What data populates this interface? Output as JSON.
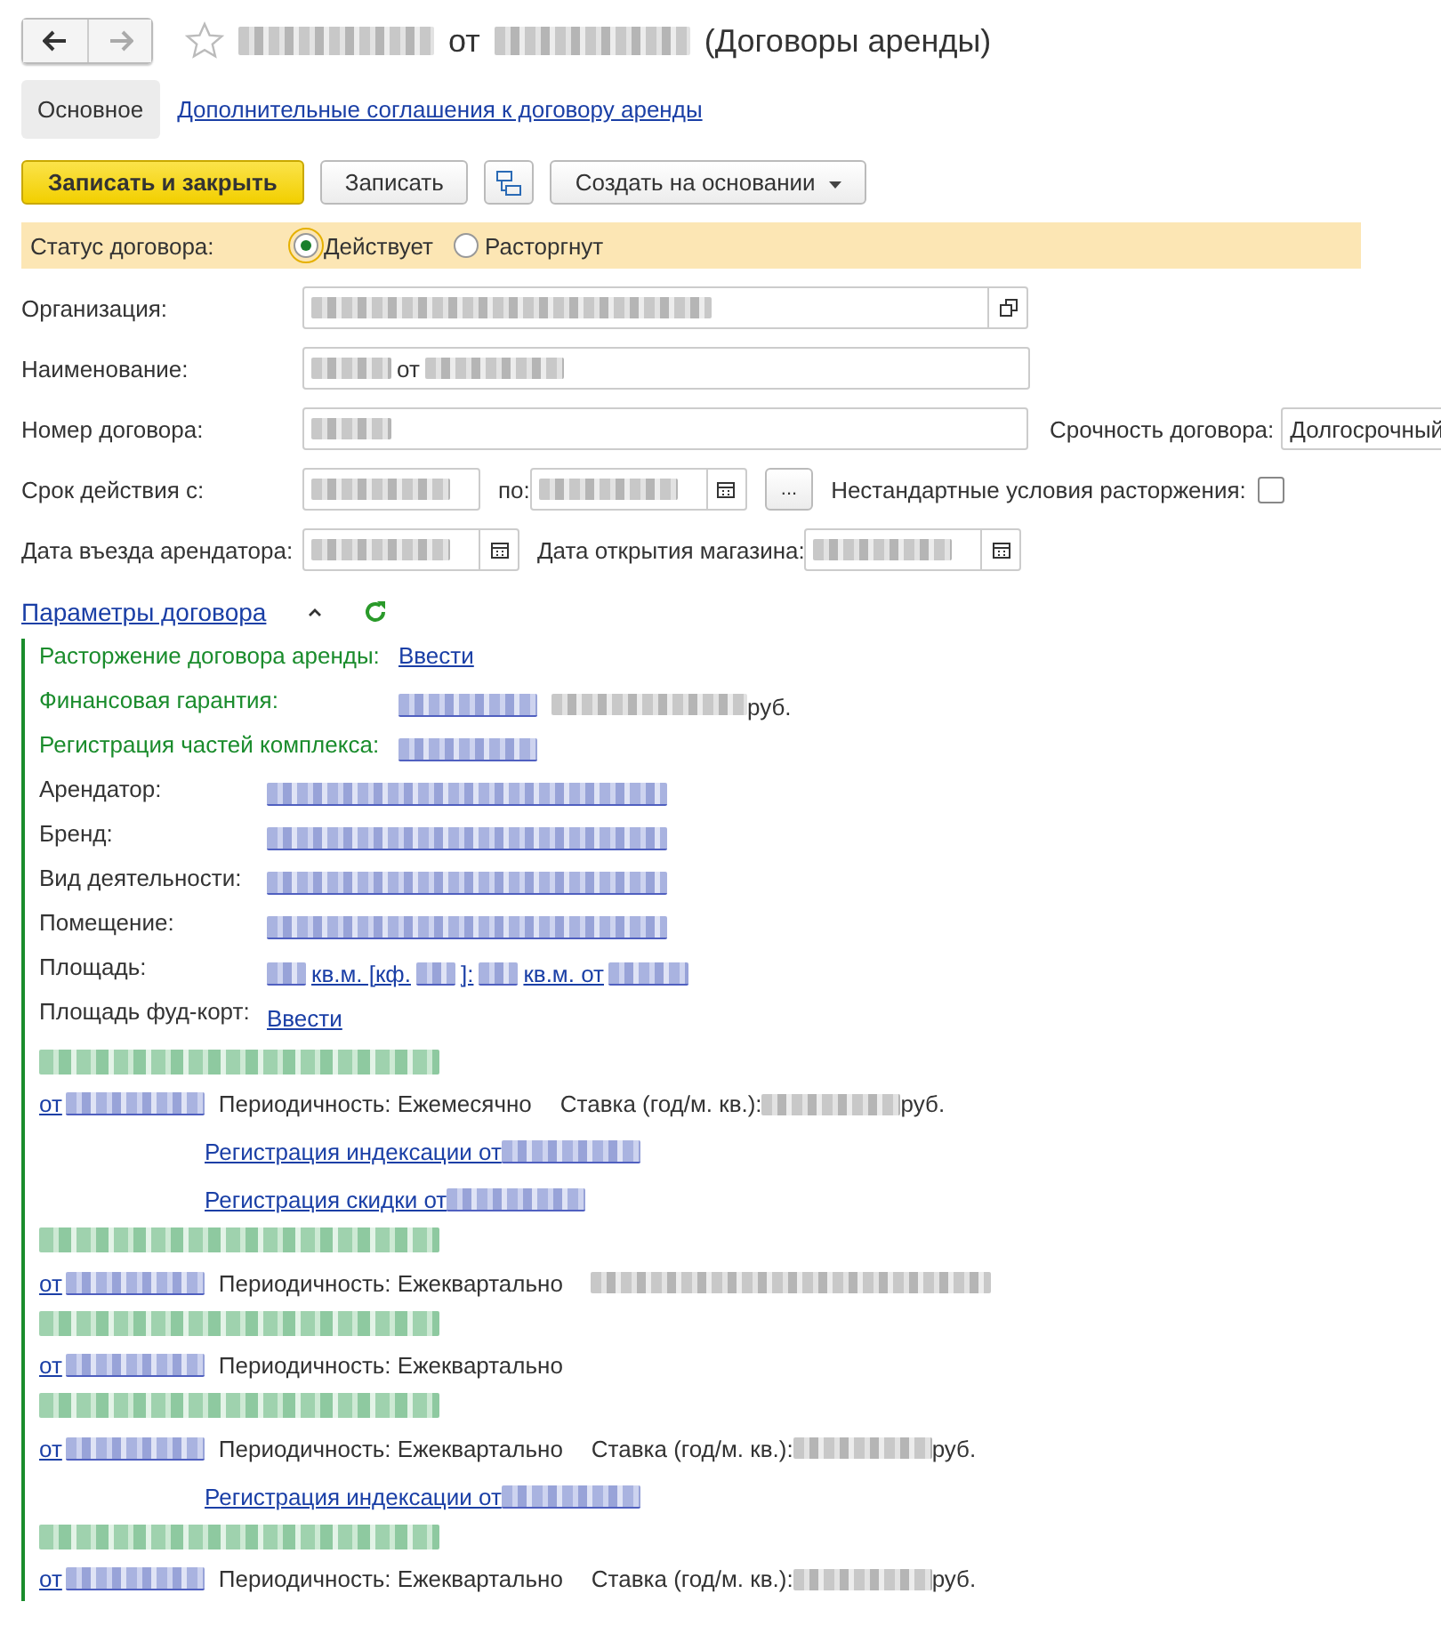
{
  "window": {
    "title_mid": "от",
    "title_end": "(Договоры аренды)"
  },
  "tabs": [
    {
      "label": "Основное",
      "selected": true
    },
    {
      "label": "Дополнительные соглашения к договору аренды",
      "selected": false
    }
  ],
  "toolbar": {
    "primary": "Записать и закрыть",
    "save": "Записать",
    "create": "Создать на основании"
  },
  "status": {
    "label": "Статус договора:",
    "options": [
      {
        "label": "Действует",
        "selected": true
      },
      {
        "label": "Расторгнут",
        "selected": false
      }
    ]
  },
  "form": {
    "organization": "Организация:",
    "name": "Наименование:",
    "name_mid": "от",
    "number": "Номер договора:",
    "urgency": "Срочность договора:",
    "urgency_value": "Долгосрочный",
    "term_from": "Срок действия с:",
    "term_to": "по:",
    "more": "...",
    "nonstandard": "Нестандартные условия расторжения:",
    "nonstandard_checked": false,
    "move_in": "Дата въезда арендатора:",
    "opening": "Дата открытия магазина:"
  },
  "params": {
    "title": "Параметры договора",
    "expanded": true,
    "green_items": [
      {
        "label": "Расторжение договора аренды:",
        "kind": "enter",
        "link": "Ввести"
      },
      {
        "label": "Финансовая гарантия:",
        "kind": "amount",
        "unit": "руб."
      },
      {
        "label": "Регистрация частей комплекса:",
        "kind": "date"
      }
    ],
    "items": [
      {
        "label": "Арендатор:",
        "kind": "blur"
      },
      {
        "label": "Бренд:",
        "kind": "blur"
      },
      {
        "label": "Вид деятельности:",
        "kind": "blur"
      },
      {
        "label": "Помещение:",
        "kind": "blur"
      },
      {
        "label": "Площадь:",
        "kind": "area",
        "parts": [
          "кв.м. [кф.",
          "]:",
          "кв.м. от"
        ]
      },
      {
        "label": "Площадь фуд-корт:",
        "kind": "enter",
        "link": "Ввести"
      }
    ],
    "payments": [
      {
        "kind": "rate",
        "from": "от",
        "period": "Периодичность: Ежемесячно",
        "rate": "Ставка (год/м. кв.):",
        "unit": "руб.",
        "links": [
          "Регистрация индексации от",
          "Регистрация скидки от"
        ]
      },
      {
        "kind": "blurred",
        "from": "от",
        "period": "Периодичность: Ежеквартально"
      },
      {
        "kind": "plain",
        "from": "от",
        "period": "Периодичность: Ежеквартально"
      },
      {
        "kind": "rate",
        "from": "от",
        "period": "Периодичность: Ежеквартально",
        "rate": "Ставка (год/м. кв.):",
        "unit": "руб.",
        "links": [
          "Регистрация индексации от"
        ]
      },
      {
        "kind": "rate",
        "from": "от",
        "period": "Периодичность: Ежеквартально",
        "rate": "Ставка (год/м. кв.):",
        "unit": "руб."
      }
    ]
  }
}
